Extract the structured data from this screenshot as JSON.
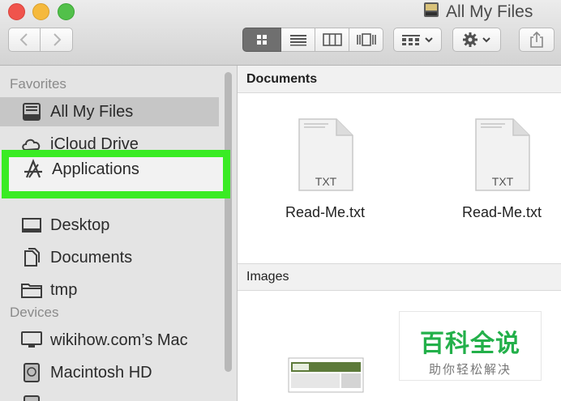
{
  "window": {
    "title": "All My Files",
    "controls": [
      "close",
      "minimize",
      "zoom"
    ]
  },
  "toolbar": {
    "nav": [
      "back-icon",
      "forward-icon"
    ],
    "view_modes": [
      "icon-view-icon",
      "list-view-icon",
      "column-view-icon",
      "cover-flow-icon"
    ],
    "active_view": "icon-view",
    "arrange_icon": "arrange-icon",
    "action_icon": "gear-icon",
    "share_icon": "share-icon"
  },
  "sidebar": {
    "favorites_heading": "Favorites",
    "favorites": [
      {
        "label": "All My Files",
        "icon": "all-my-files-icon",
        "selected": true
      },
      {
        "label": "iCloud Drive",
        "icon": "cloud-icon"
      },
      {
        "label": "Applications",
        "icon": "applications-icon",
        "highlighted": true
      },
      {
        "label": "Desktop",
        "icon": "desktop-icon"
      },
      {
        "label": "Documents",
        "icon": "documents-icon"
      },
      {
        "label": "tmp",
        "icon": "folder-icon"
      }
    ],
    "devices_heading": "Devices",
    "devices": [
      {
        "label": "wikihow.com’s Mac",
        "icon": "computer-icon"
      },
      {
        "label": "Macintosh HD",
        "icon": "hard-drive-icon"
      }
    ]
  },
  "content": {
    "documents_header": "Documents",
    "files": [
      {
        "name": "Read-Me.txt",
        "type": "TXT"
      },
      {
        "name": "Read-Me.txt",
        "type": "TXT"
      }
    ],
    "images_header": "Images"
  },
  "watermark": {
    "title": "百科全说",
    "subtitle": "助你轻松解决"
  },
  "colors": {
    "highlight": "#3aeb24",
    "selection": "#c6c6c6"
  }
}
